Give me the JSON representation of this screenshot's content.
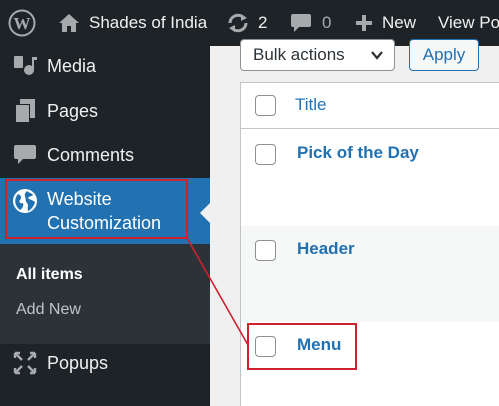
{
  "adminbar": {
    "site_name": "Shades of India",
    "updates_count": "2",
    "comments_count": "0",
    "new_label": "New",
    "view_label": "View Po"
  },
  "sidebar": {
    "items": [
      {
        "label": "Media",
        "icon": "media-icon"
      },
      {
        "label": "Pages",
        "icon": "pages-icon"
      },
      {
        "label": "Comments",
        "icon": "comments-icon"
      },
      {
        "label": "Website Customization",
        "label_line1": "Website",
        "label_line2": "Customization",
        "icon": "globe-icon",
        "active": true
      },
      {
        "label": "Popups",
        "icon": "popups-icon"
      }
    ],
    "submenu": {
      "all_items": "All items",
      "add_new": "Add New"
    }
  },
  "main": {
    "bulk_actions_label": "Bulk actions",
    "apply_label": "Apply",
    "table": {
      "header_title": "Title",
      "rows": [
        {
          "title": "Pick of the Day"
        },
        {
          "title": "Header"
        },
        {
          "title": "Menu"
        }
      ]
    }
  },
  "colors": {
    "adminbar_bg": "#1d2327",
    "accent": "#2271b1",
    "annotation": "#d0202e"
  }
}
